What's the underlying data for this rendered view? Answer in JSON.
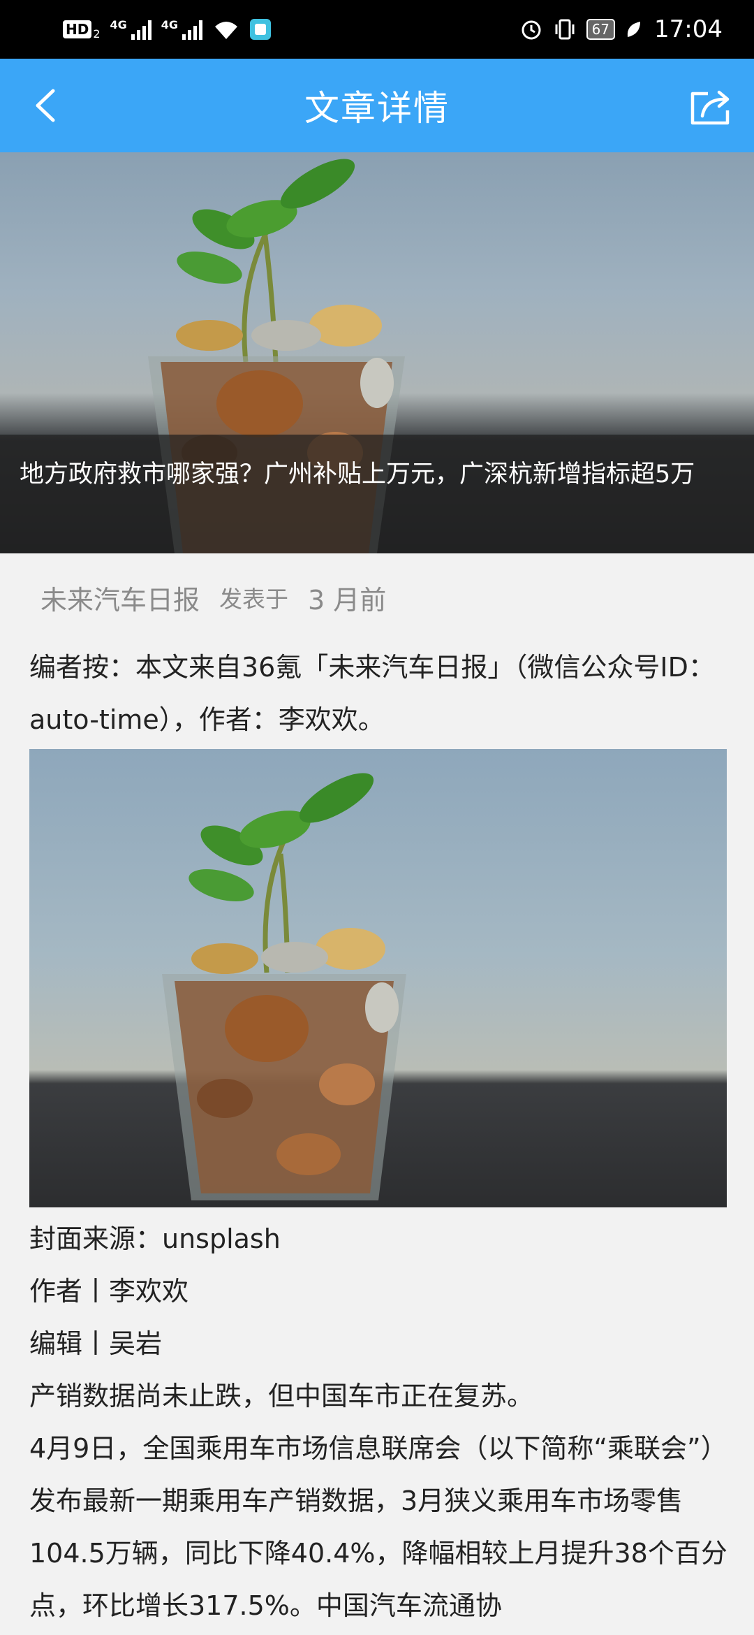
{
  "status_bar": {
    "hd_label": "HD",
    "sim_index": "2",
    "net1": "4G",
    "net2": "4G",
    "battery": "67",
    "time": "17:04"
  },
  "nav": {
    "title": "文章详情",
    "back_icon": "chevron-left-icon",
    "share_icon": "share-icon"
  },
  "hero": {
    "title": "地方政府救市哪家强？广州补贴上万元，广深杭新增指标超5万"
  },
  "meta": {
    "source": "未来汽车日报",
    "published_label": "发表于",
    "time_ago": "3 月前"
  },
  "article": {
    "editor_note": "编者按：本文来自36氪「未来汽车日报」（微信公众号ID：auto-time），作者：李欢欢。",
    "cover_source": "封面来源：unsplash",
    "author_line": "作者丨李欢欢",
    "editor_line": "编辑丨吴岩",
    "p1": "产销数据尚未止跌，但中国车市正在复苏。",
    "p2": "4月9日，全国乘用车市场信息联席会（以下简称“乘联会”）发布最新一期乘用车产销数据，3月狭义乘用车市场零售104.5万辆，同比下降40.4%，降幅相较上月提升38个百分点，环比增长317.5%。中国汽车流通协"
  }
}
